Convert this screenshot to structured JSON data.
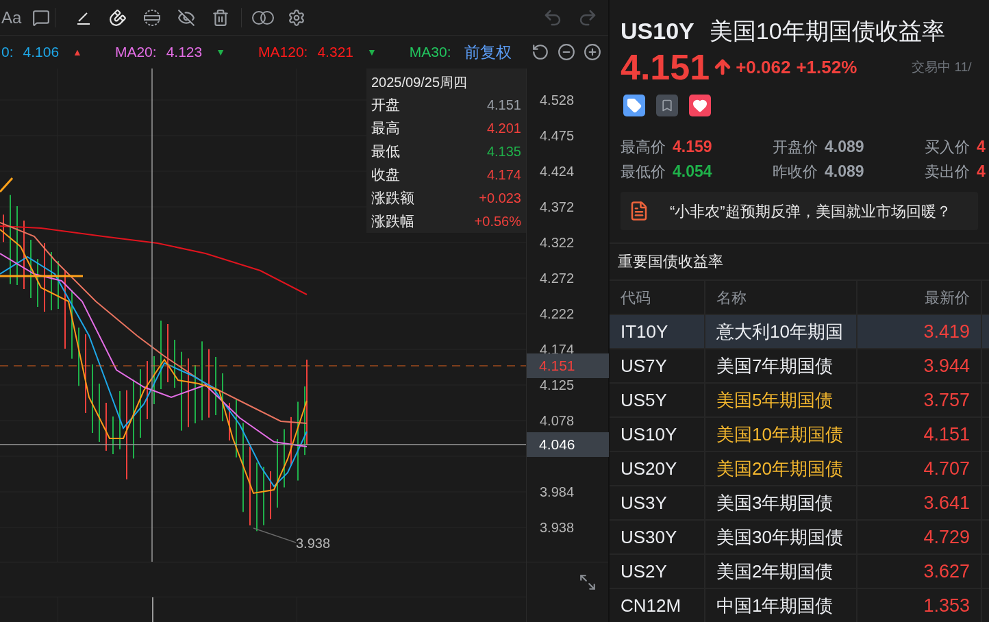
{
  "toolbar": {
    "text_tool": "Aa"
  },
  "indicators": [
    {
      "label": "0:",
      "value": "4.106",
      "arrow": {
        "symbol": "▲",
        "color": "#f0403c"
      },
      "color": "#1ea7e8"
    },
    {
      "label": "MA20:",
      "value": "4.123",
      "arrow": {
        "symbol": "▼",
        "color": "#1fb14a"
      },
      "color": "#e46ee6"
    },
    {
      "label": "MA120:",
      "value": "4.321",
      "arrow": {
        "symbol": "▼",
        "color": "#1fb14a"
      },
      "color": "#ff1a1a"
    },
    {
      "label": "MA30:",
      "color": "#22c55e"
    }
  ],
  "adjustment": "前复权",
  "tooltip": {
    "date": "2025/09/25周四",
    "rows": [
      {
        "label": "开盘",
        "value": "4.151",
        "color": "#9aa0a8"
      },
      {
        "label": "最高",
        "value": "4.201",
        "color": "#f0403c"
      },
      {
        "label": "最低",
        "value": "4.135",
        "color": "#1fb14a"
      },
      {
        "label": "收盘",
        "value": "4.174",
        "color": "#f0403c"
      },
      {
        "label": "涨跌额",
        "value": "+0.023",
        "color": "#f0403c"
      },
      {
        "label": "涨跌幅",
        "value": "+0.56%",
        "color": "#f0403c"
      }
    ]
  },
  "price_axis": [
    "4.528",
    "4.475",
    "4.424",
    "4.372",
    "4.322",
    "4.272",
    "4.222",
    "4.174",
    "4.125",
    "4.078",
    "3.984",
    "3.938"
  ],
  "price_tags": [
    {
      "text": "4.151",
      "kind": "last"
    },
    {
      "text": "4.046",
      "kind": "cursor"
    }
  ],
  "low_marker": "3.938",
  "quote": {
    "symbol": "US10Y",
    "name": "美国10年期国债收益率",
    "price": "4.151",
    "change": "+0.062",
    "change_pct": "+1.52%",
    "status": "交易中 11/"
  },
  "stats": [
    {
      "label": "最高价",
      "value": "4.159",
      "color": "#f0403c"
    },
    {
      "label": "开盘价",
      "value": "4.089",
      "color": "#9aa0a8"
    },
    {
      "label": "买入价",
      "value": "4",
      "color": "#f0403c"
    },
    {
      "label": "最低价",
      "value": "4.054",
      "color": "#1fb14a"
    },
    {
      "label": "昨收价",
      "value": "4.089",
      "color": "#9aa0a8"
    },
    {
      "label": "卖出价",
      "value": "4",
      "color": "#f0403c"
    }
  ],
  "news": {
    "headline": "“小非农”超预期反弹，美国就业市场回暖？"
  },
  "section_title": "重要国债收益率",
  "table": {
    "columns": [
      "代码",
      "名称",
      "最新价"
    ],
    "rows": [
      {
        "code": "IT10Y",
        "name": "意大利10年期国",
        "price": "3.419",
        "selected": true,
        "highlighted": false
      },
      {
        "code": "US7Y",
        "name": "美国7年期国债",
        "price": "3.944",
        "selected": false,
        "highlighted": false
      },
      {
        "code": "US5Y",
        "name": "美国5年期国债",
        "price": "3.757",
        "selected": false,
        "highlighted": true
      },
      {
        "code": "US10Y",
        "name": "美国10年期国债",
        "price": "4.151",
        "selected": false,
        "highlighted": true
      },
      {
        "code": "US20Y",
        "name": "美国20年期国债",
        "price": "4.707",
        "selected": false,
        "highlighted": true
      },
      {
        "code": "US3Y",
        "name": "美国3年期国债",
        "price": "3.641",
        "selected": false,
        "highlighted": false
      },
      {
        "code": "US30Y",
        "name": "美国30年期国债",
        "price": "4.729",
        "selected": false,
        "highlighted": false
      },
      {
        "code": "US2Y",
        "name": "美国2年期国债",
        "price": "3.627",
        "selected": false,
        "highlighted": false
      },
      {
        "code": "CN12M",
        "name": "中国1年期国债",
        "price": "1.353",
        "selected": false,
        "highlighted": false
      }
    ]
  }
}
